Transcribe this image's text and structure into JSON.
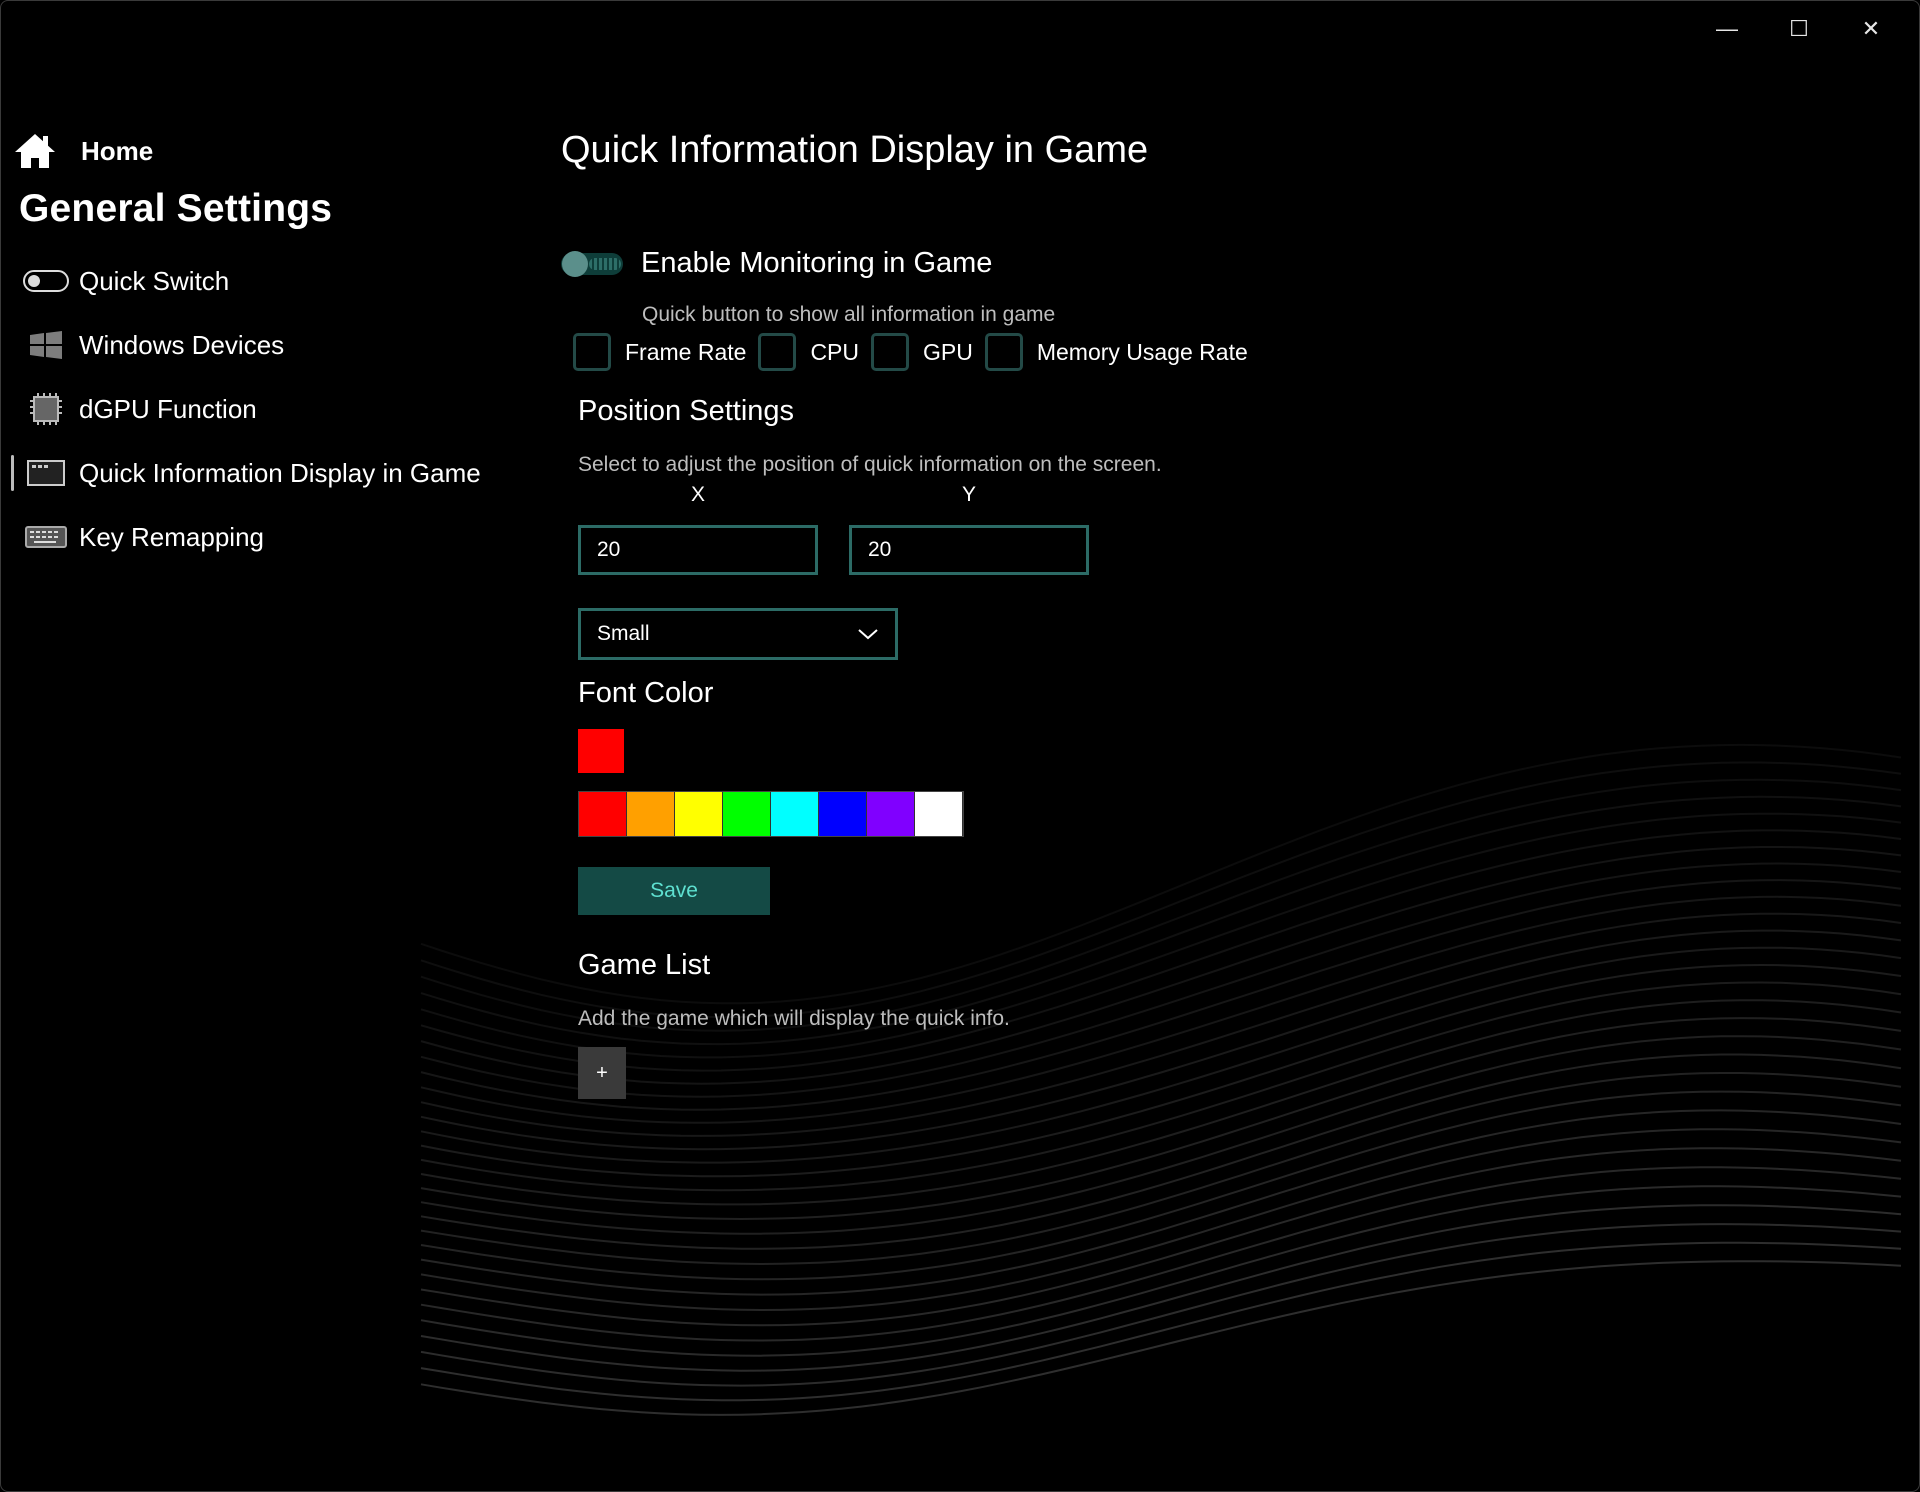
{
  "window": {
    "minimize_glyph": "—",
    "maximize_glyph": "☐",
    "close_glyph": "✕"
  },
  "sidebar": {
    "home_label": "Home",
    "title": "General Settings",
    "items": [
      {
        "label": "Quick Switch",
        "icon": "toggle-icon"
      },
      {
        "label": "Windows Devices",
        "icon": "windows-icon"
      },
      {
        "label": "dGPU Function",
        "icon": "chip-icon"
      },
      {
        "label": "Quick Information Display in Game",
        "icon": "monitor-icon",
        "active": true
      },
      {
        "label": "Key Remapping",
        "icon": "keyboard-icon"
      }
    ]
  },
  "main": {
    "title": "Quick Information Display in Game",
    "enable_label": "Enable Monitoring in Game",
    "enable_hint": "Quick button to show all information in game",
    "checkboxes": [
      {
        "label": "Frame Rate",
        "checked": false
      },
      {
        "label": "CPU",
        "checked": false
      },
      {
        "label": "GPU",
        "checked": false
      },
      {
        "label": "Memory Usage Rate",
        "checked": false
      }
    ],
    "position": {
      "title": "Position Settings",
      "hint": "Select to adjust the position of quick information on the screen.",
      "x_label": "X",
      "y_label": "Y",
      "x_value": "20",
      "y_value": "20"
    },
    "size_select": {
      "value": "Small"
    },
    "font_color": {
      "title": "Font Color",
      "current": "#ff0000",
      "palette": [
        "#ff0000",
        "#ffa000",
        "#ffff00",
        "#00ff00",
        "#00ffff",
        "#0000ff",
        "#8000ff",
        "#ffffff"
      ]
    },
    "save_label": "Save",
    "game_list": {
      "title": "Game List",
      "hint": "Add the game which will display the quick info.",
      "add_label": "+"
    }
  },
  "colors": {
    "accent": "#2c6b66",
    "save_bg": "#144a45",
    "save_text": "#5ee0d0"
  }
}
